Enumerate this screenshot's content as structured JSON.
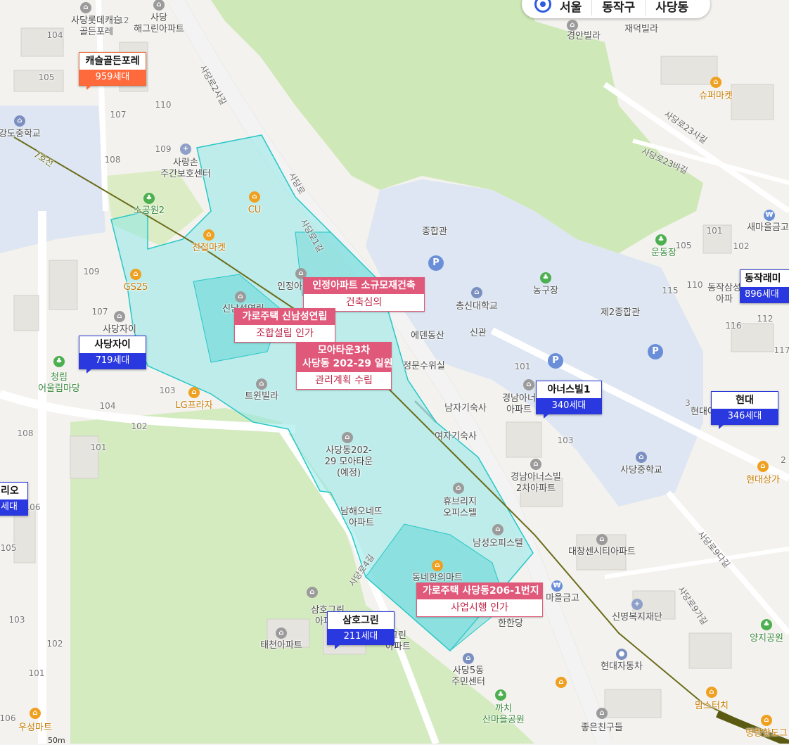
{
  "location_bar": {
    "city": "서울",
    "district": "동작구",
    "dong": "사당동"
  },
  "complex_markers": [
    {
      "name": "캐슬골든포레",
      "households": "959세대",
      "style": "orange"
    },
    {
      "name": "사당자이",
      "households": "719세대",
      "style": "blue"
    },
    {
      "name": "아너스빌1",
      "households": "340세대",
      "style": "blue"
    },
    {
      "name": "현대",
      "households": "346세대",
      "style": "blue"
    },
    {
      "name": "동작래미",
      "households": "896세대",
      "style": "blue"
    },
    {
      "name": "삼호그린",
      "households": "211세대",
      "style": "blue"
    },
    {
      "name": "리오",
      "households": "세대",
      "style": "blue"
    }
  ],
  "redevelopment_markers": [
    {
      "title": "인정아파트 소규모재건축",
      "status": "건축심의"
    },
    {
      "title": "가로주택 신남성연립",
      "status": "조합설립 인가"
    },
    {
      "title": "모아타운3차\n사당동 202-29 일원",
      "status": "관리계획 수립"
    },
    {
      "title": "가로주택 사당동206-1번지",
      "status": "사업시행 인가"
    }
  ],
  "places": [
    "사당롯데캐슬\n골든포레",
    "사당\n해그린아파트",
    "경안빌라",
    "재덕빌라",
    "슈퍼마켓",
    "강도중학교",
    "사랑손\n주간보호센터",
    "소공원2",
    "CU",
    "친절마켓",
    "GS25",
    "종합관",
    "총신대학교",
    "농구장",
    "제2종합관",
    "에덴동산",
    "신관",
    "정문수위실",
    "인정아",
    "신남성연립",
    "트윈빌라",
    "사당자이",
    "청림\n어울림마당",
    "LG프라자",
    "남자기숙사",
    "여자기숙사",
    "경남아너\n아파트",
    "경남아너스빌\n2차아파트",
    "사당중학교",
    "현대상가",
    "새마을금고",
    "운동장",
    "동작삼성\n아파",
    "현대아",
    "사당동202-\n29 모아타운\n(예정)",
    "휴브리지\n오피스텔",
    "남성오피스텔",
    "남해오네뜨\n아파트",
    "동네한의마트",
    "마을금고",
    "한한당",
    "대창센시티아파트",
    "신명복지재단",
    "양지공원",
    "현대자동차",
    "삼호그린\n아파트",
    "태천아파트",
    "그린\n아파트",
    "사당5동\n주민센터",
    "까치\n산마을공원",
    "좋은친구들",
    "맘스터치",
    "명랑핫도그",
    "우성마트"
  ],
  "road_labels": [
    "사당로2사길",
    "사당로",
    "사당로23사길",
    "사당로23바길",
    "사당로9다길",
    "사당로9가길",
    "사당로4길",
    "사당로1길"
  ],
  "subway_line_label": "7호선",
  "building_numbers": [
    "112",
    "104",
    "105",
    "107",
    "110",
    "109",
    "108",
    "109",
    "107",
    "103",
    "104",
    "102",
    "101",
    "108",
    "101",
    "105",
    "102",
    "115",
    "110",
    "116",
    "112",
    "117",
    "101",
    "103",
    "3",
    "2",
    "106",
    "105",
    "103",
    "102",
    "101",
    "106"
  ],
  "scale_label": "50m",
  "colors": {
    "zone_fill": "#8fe8e8",
    "zone_stroke": "#27c7c7",
    "orange_marker": "#ff6a3d",
    "blue_marker": "#2a38e0",
    "redevelopment_header": "#e0587a",
    "subway_line": "#6b6b1a",
    "park": "#c8e6b0",
    "campus": "#dfe6f2"
  }
}
